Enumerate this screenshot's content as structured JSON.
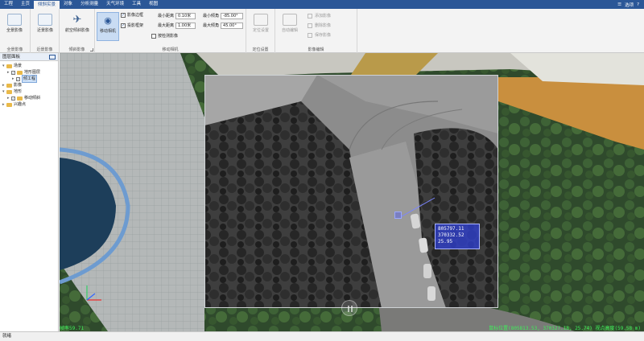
{
  "tabs": [
    "工程",
    "主页",
    "倾斜实景",
    "对象",
    "分析测量",
    "天气环境",
    "工具",
    "视图"
  ],
  "active_tab_index": 2,
  "header_right": {
    "label": "选项",
    "help": "?"
  },
  "ribbon": {
    "groups": [
      {
        "title": "全景影像"
      },
      {
        "title": "近景影像"
      },
      {
        "title": "倾斜影像"
      },
      {
        "title": "移动相机"
      },
      {
        "title": "定位设置"
      },
      {
        "title": "影像编辑"
      }
    ],
    "buttons": {
      "full_view": "全景影像",
      "near_view": "近景影像",
      "near_flight": "航空倾斜影像",
      "move_camera": "移动相机",
      "locate": "定位设置",
      "auto_edit": "自动编辑"
    },
    "view_options": {
      "image_edge": "影像边框",
      "projection_frame": "投影框架",
      "follow_project": "按检测影像"
    },
    "params": {
      "min_distance_label": "最小距离",
      "min_distance": "0.10米",
      "max_distance_label": "最大距离",
      "max_distance": "1.00米",
      "min_tilt_label": "最小倾角",
      "min_tilt": "-85.00°",
      "max_tilt_label": "最大倾角",
      "max_tilt": "45.00°"
    },
    "image_edit": [
      "添加影像",
      "删除影像",
      "保存影像"
    ]
  },
  "layer_panel": {
    "title": "图层面板",
    "tree": [
      {
        "label": "场景",
        "level": 0,
        "expanded": true,
        "checked": null,
        "folder": true
      },
      {
        "label": "地形图层",
        "level": 1,
        "expanded": false,
        "checked": true,
        "folder": true
      },
      {
        "label": "倾工程",
        "level": 2,
        "expanded": false,
        "checked": true,
        "folder": false,
        "selected": true
      },
      {
        "label": "影像",
        "level": 0,
        "expanded": false,
        "checked": null,
        "folder": true
      },
      {
        "label": "地形",
        "level": 0,
        "expanded": true,
        "checked": null,
        "folder": true
      },
      {
        "label": "移动倾斜",
        "level": 1,
        "expanded": false,
        "checked": true,
        "folder": true
      },
      {
        "label": "兴趣点",
        "level": 0,
        "expanded": false,
        "checked": null,
        "folder": true
      }
    ]
  },
  "callout": {
    "line1": "805797.11",
    "line2": "370332.52",
    "line3": "25.95"
  },
  "overlay": {
    "fps": "帧率59.71",
    "coords": "鼠标位置(805813.53, 370327.18, 25.74)  视点高度(59.58 m)"
  },
  "status": {
    "text": "就绪"
  },
  "colors": {
    "ribbon_blue": "#2b5797",
    "overlay_green": "#3ef05a",
    "callout_blue": "#3040c8"
  }
}
